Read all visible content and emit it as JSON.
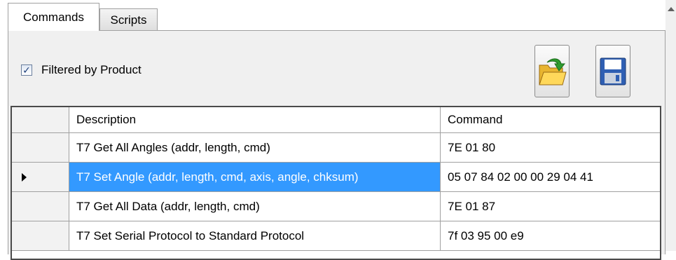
{
  "tabs": [
    {
      "label": "Commands",
      "active": true
    },
    {
      "label": "Scripts",
      "active": false
    }
  ],
  "filter": {
    "label": "Filtered by Product",
    "checked": true
  },
  "toolbar": {
    "open_icon": "folder-open-icon",
    "save_icon": "floppy-disk-icon"
  },
  "grid": {
    "columns": [
      "Description",
      "Command"
    ],
    "rows": [
      {
        "description": "T7 Get All Angles (addr, length, cmd)",
        "command": "7E 01 80",
        "selected": false
      },
      {
        "description": "T7 Set Angle  (addr, length, cmd, axis, angle, chksum)",
        "command": "05 07 84 02 00 00 29 04 41",
        "selected": true
      },
      {
        "description": "T7 Get All Data (addr, length, cmd)",
        "command": "7E 01 87",
        "selected": false
      },
      {
        "description": "T7 Set Serial Protocol to Standard Protocol",
        "command": "7f 03 95 00 e9",
        "selected": false
      }
    ]
  },
  "colors": {
    "selection": "#3399ff",
    "panel": "#f0f0f0",
    "accent_green": "#2e9b2e",
    "floppy_blue": "#2f5fb3"
  }
}
